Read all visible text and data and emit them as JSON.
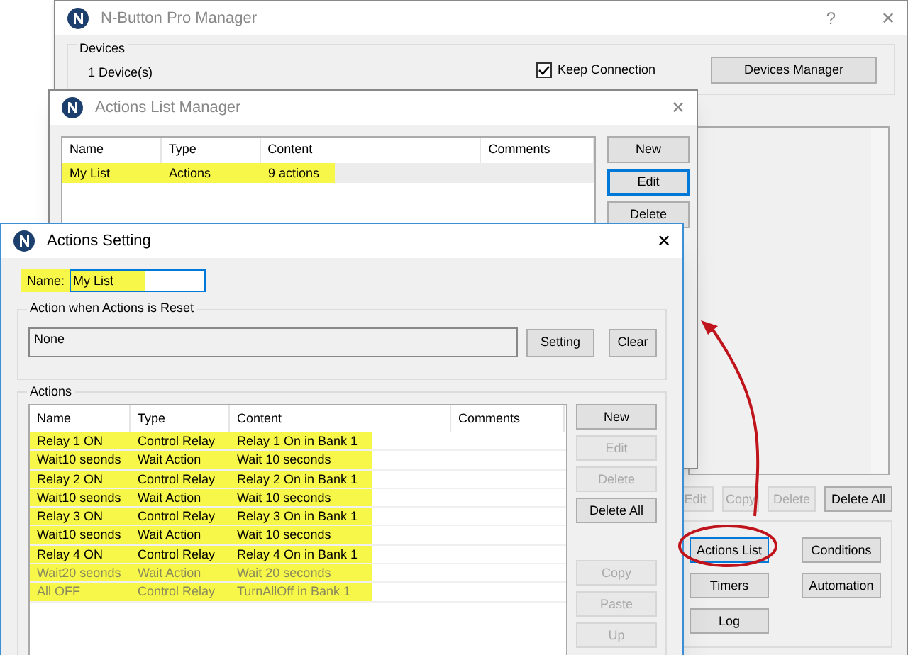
{
  "main_window": {
    "title": "N-Button Pro Manager",
    "help": "?",
    "close": "✕",
    "devices": {
      "label": "Devices",
      "count": "1 Device(s)",
      "keep_connection": {
        "label": "Keep Connection",
        "checked": true
      },
      "button": "Devices Manager"
    },
    "list_buttons": [
      {
        "label": "Edit",
        "disabled": true
      },
      {
        "label": "Copy",
        "disabled": true
      },
      {
        "label": "Delete",
        "disabled": true
      },
      {
        "label": "Delete All",
        "disabled": false
      }
    ],
    "feature_buttons": [
      {
        "label": "Actions List",
        "selected": true
      },
      {
        "label": "Conditions",
        "selected": false
      },
      {
        "label": "Timers",
        "selected": false
      },
      {
        "label": "Automation",
        "selected": false
      },
      {
        "label": "Log",
        "selected": false
      }
    ]
  },
  "list_manager": {
    "title": "Actions List Manager",
    "close": "✕",
    "columns": [
      "Name",
      "Type",
      "Content",
      "Comments"
    ],
    "rows": [
      {
        "cells": [
          "My List",
          "Actions",
          "9 actions",
          ""
        ],
        "highlighted": true
      }
    ],
    "buttons": [
      {
        "label": "New",
        "focused": false
      },
      {
        "label": "Edit",
        "focused": true
      },
      {
        "label": "Delete",
        "focused": false
      }
    ]
  },
  "actions_setting": {
    "title": "Actions Setting",
    "close": "✕",
    "name": {
      "label": "Name:",
      "value": "My List"
    },
    "reset_group": {
      "label": "Action when Actions is Reset",
      "value": "None",
      "buttons": [
        "Setting",
        "Clear"
      ]
    },
    "actions_group": {
      "label": "Actions",
      "columns": [
        "Name",
        "Type",
        "Content",
        "Comments"
      ],
      "rows": [
        {
          "cells": [
            "Relay 1 ON",
            "Control Relay",
            "Relay 1 On in Bank 1"
          ],
          "faded": false
        },
        {
          "cells": [
            "Wait10 seonds",
            "Wait Action",
            "Wait 10 seconds"
          ],
          "faded": false
        },
        {
          "cells": [
            "Relay 2 ON",
            "Control Relay",
            "Relay 2 On in Bank 1"
          ],
          "faded": false
        },
        {
          "cells": [
            "Wait10 seonds",
            "Wait Action",
            "Wait 10 seconds"
          ],
          "faded": false
        },
        {
          "cells": [
            "Relay 3 ON",
            "Control Relay",
            "Relay 3 On in Bank 1"
          ],
          "faded": false
        },
        {
          "cells": [
            "Wait10 seonds",
            "Wait Action",
            "Wait 10 seconds"
          ],
          "faded": false
        },
        {
          "cells": [
            "Relay 4 ON",
            "Control Relay",
            "Relay 4 On in Bank 1"
          ],
          "faded": false
        },
        {
          "cells": [
            "Wait20 seonds",
            "Wait Action",
            "Wait 20 seconds"
          ],
          "faded": true
        },
        {
          "cells": [
            "All OFF",
            "Control Relay",
            "TurnAllOff in Bank 1"
          ],
          "faded": true
        }
      ],
      "buttons": [
        {
          "label": "New",
          "disabled": false
        },
        {
          "label": "Edit",
          "disabled": true
        },
        {
          "label": "Delete",
          "disabled": true
        },
        {
          "label": "Delete All",
          "disabled": false
        }
      ],
      "clipboard_buttons": [
        {
          "label": "Copy",
          "disabled": true
        },
        {
          "label": "Paste",
          "disabled": true
        },
        {
          "label": "Up",
          "disabled": true
        }
      ]
    }
  }
}
